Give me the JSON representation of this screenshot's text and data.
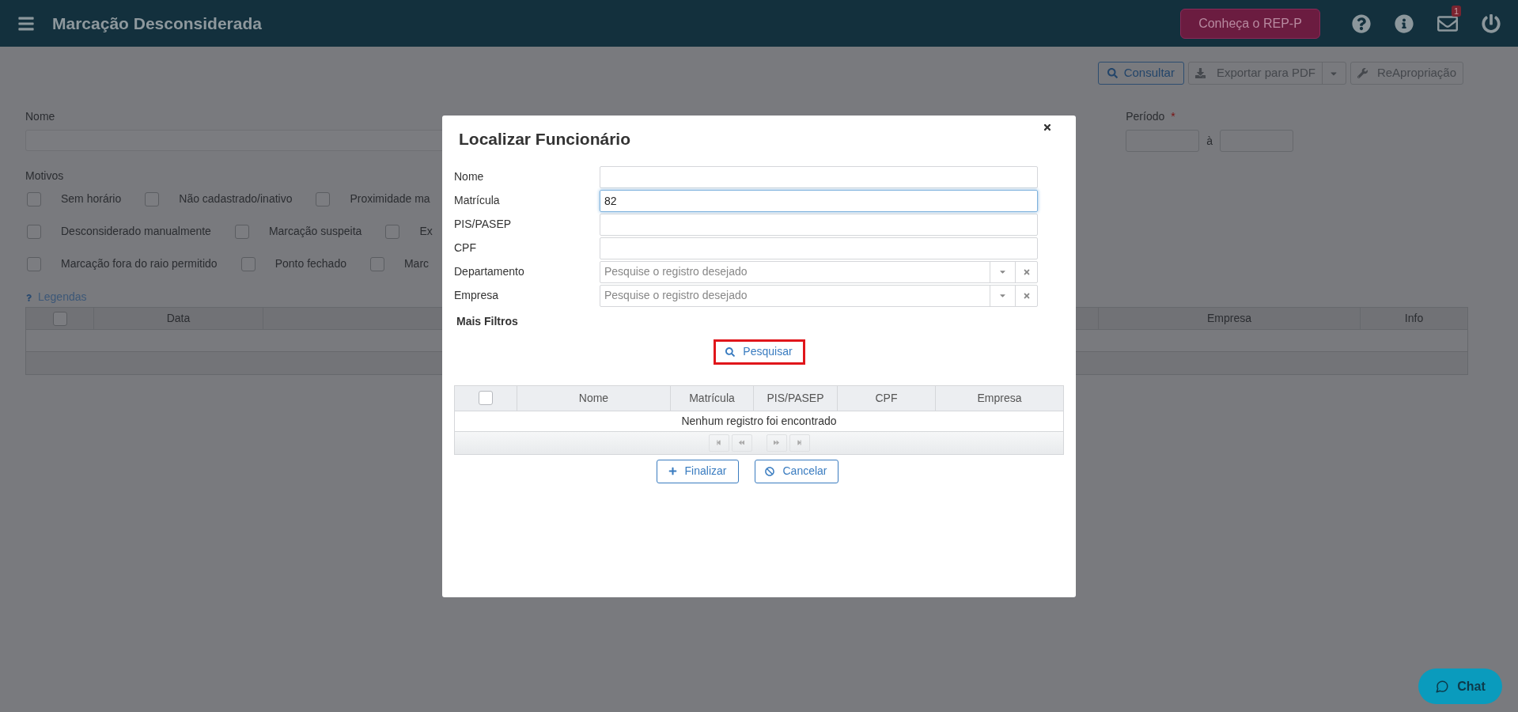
{
  "header": {
    "title": "Marcação Desconsiderada",
    "promo_button": "Conheça o REP-P",
    "mail_badge": "1"
  },
  "toolbar": {
    "consult_button": {
      "label": "Consultar",
      "disabled": false
    },
    "export_button": {
      "label": "Exportar para PDF",
      "disabled": true
    },
    "reappropriation_button": {
      "label": "ReApropriação",
      "disabled": true
    }
  },
  "filters": {
    "name_label": "Nome",
    "period_label": "Período",
    "required_mark": "*",
    "period_separator": "à"
  },
  "motivos": {
    "label": "Motivos",
    "rows": [
      [
        {
          "label": "Sem horário",
          "checked": false
        },
        {
          "label": "Não cadastrado/inativo",
          "checked": false
        },
        {
          "label": "Proximidade ma",
          "checked": false
        }
      ],
      [
        {
          "label": "Desconsiderado manualmente",
          "checked": false
        },
        {
          "label": "Marcação suspeita",
          "checked": false
        },
        {
          "label": "Ex",
          "checked": false
        }
      ],
      [
        {
          "label": "Marcação fora do raio permitido",
          "checked": false
        },
        {
          "label": "Ponto fechado",
          "checked": false
        },
        {
          "label": "Marc",
          "checked": false
        }
      ]
    ]
  },
  "legend_link": "Legendas",
  "table": {
    "header_checked": false,
    "columns": [
      "Data",
      "Empresa",
      "Info"
    ]
  },
  "modal": {
    "title": "Localizar Funcionário",
    "fields": [
      {
        "label": "Nome",
        "kind": "text",
        "focused": false
      },
      {
        "label": "Matrícula",
        "kind": "text",
        "value": "82",
        "focused": true
      },
      {
        "label": "PIS/PASEP",
        "kind": "text",
        "focused": false
      },
      {
        "label": "CPF",
        "kind": "text",
        "focused": false
      },
      {
        "label": "Departamento",
        "kind": "lookup",
        "placeholder": "Pesquise o registro desejado",
        "focused": false
      },
      {
        "label": "Empresa",
        "kind": "lookup",
        "placeholder": "Pesquise o registro desejado",
        "focused": false
      }
    ],
    "more_filters": "Mais Filtros",
    "search_button": {
      "label": "Pesquisar",
      "highlighted": true
    },
    "results": {
      "header_checked": false,
      "columns": [
        "Nome",
        "Matrícula",
        "PIS/PASEP",
        "CPF",
        "Empresa"
      ],
      "empty_message": "Nenhum registro foi encontrado"
    },
    "finish_button": "Finalizar",
    "cancel_button": "Cancelar"
  },
  "chat_button": "Chat"
}
